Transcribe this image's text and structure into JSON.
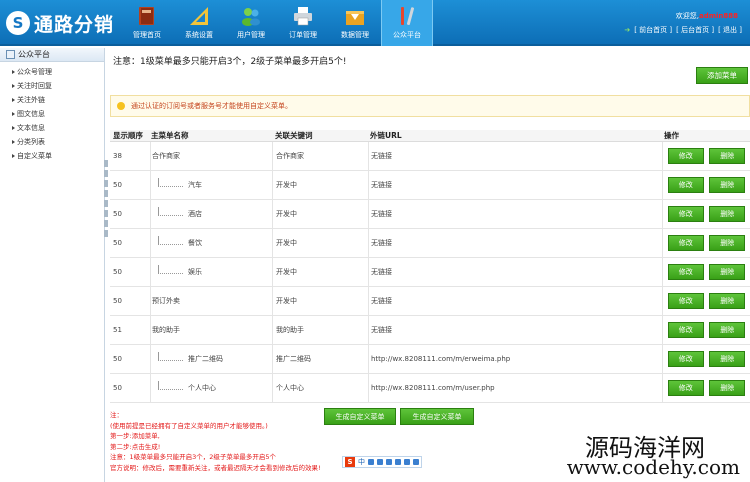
{
  "brand": {
    "logo_glyph": "S",
    "name": "通路分销",
    "accent": "#1577c4"
  },
  "nav": [
    {
      "label": "管理首页",
      "icon": "book-icon"
    },
    {
      "label": "系统设置",
      "icon": "ruler-icon"
    },
    {
      "label": "用户管理",
      "icon": "users-icon"
    },
    {
      "label": "订单管理",
      "icon": "printer-icon"
    },
    {
      "label": "数据管理",
      "icon": "download-box-icon"
    },
    {
      "label": "公众平台",
      "icon": "tools-icon",
      "active": true
    }
  ],
  "user": {
    "welcome": "欢迎您,",
    "name": "admin888",
    "links": [
      "前台首页",
      "后台首页",
      "退出"
    ]
  },
  "sidebar": {
    "title": "公众平台",
    "items": [
      "公众号管理",
      "关注时回复",
      "关注外链",
      "图文信息",
      "文本信息",
      "分类列表",
      "自定义菜单"
    ]
  },
  "main": {
    "notice": "注意：1级菜单最多只能开启3个，2级子菜单最多开启5个!",
    "add_label": "添加菜单",
    "tip": "通过认证的订阅号或者服务号才能使用自定义菜单。",
    "columns": [
      "显示顺序",
      "主菜单名称",
      "关联关键词",
      "外链URL",
      "操作"
    ],
    "rows": [
      {
        "order": "38",
        "name": "合作商家",
        "child": false,
        "keyword": "合作商家",
        "url": "无链接"
      },
      {
        "order": "50",
        "name": "汽车",
        "child": true,
        "keyword": "开发中",
        "url": "无链接"
      },
      {
        "order": "50",
        "name": "酒店",
        "child": true,
        "keyword": "开发中",
        "url": "无链接"
      },
      {
        "order": "50",
        "name": "餐饮",
        "child": true,
        "keyword": "开发中",
        "url": "无链接"
      },
      {
        "order": "50",
        "name": "娱乐",
        "child": true,
        "keyword": "开发中",
        "url": "无链接"
      },
      {
        "order": "50",
        "name": "预订外卖",
        "child": false,
        "keyword": "开发中",
        "url": "无链接"
      },
      {
        "order": "51",
        "name": "我的助手",
        "child": false,
        "keyword": "我的助手",
        "url": "无链接"
      },
      {
        "order": "50",
        "name": "推广二维码",
        "child": true,
        "keyword": "推广二维码",
        "url": "http://wx.8208111.com/m/erweima.php"
      },
      {
        "order": "50",
        "name": "个人中心",
        "child": true,
        "keyword": "个人中心",
        "url": "http://wx.8208111.com/m/user.php"
      }
    ],
    "edit_label": "修改",
    "delete_label": "删除",
    "notes": [
      "注：",
      "(使用前提是已经拥有了自定义菜单的用户才能够使用。)",
      "第一步:添加菜单,",
      "第二步:点击生成!",
      "注意：1级菜单最多只能开启3个，2级子菜单最多开启5个",
      "官方说明：修改后，需要重新关注，或者最迟隔天才会看到修改后的效果!"
    ],
    "gen_label_1": "生成自定义菜单",
    "gen_label_2": "生成自定义菜单"
  },
  "ime": {
    "logo": "S",
    "mode": "中"
  },
  "watermark": {
    "line1": "源码海洋网",
    "line2": "www.codehy.com"
  }
}
